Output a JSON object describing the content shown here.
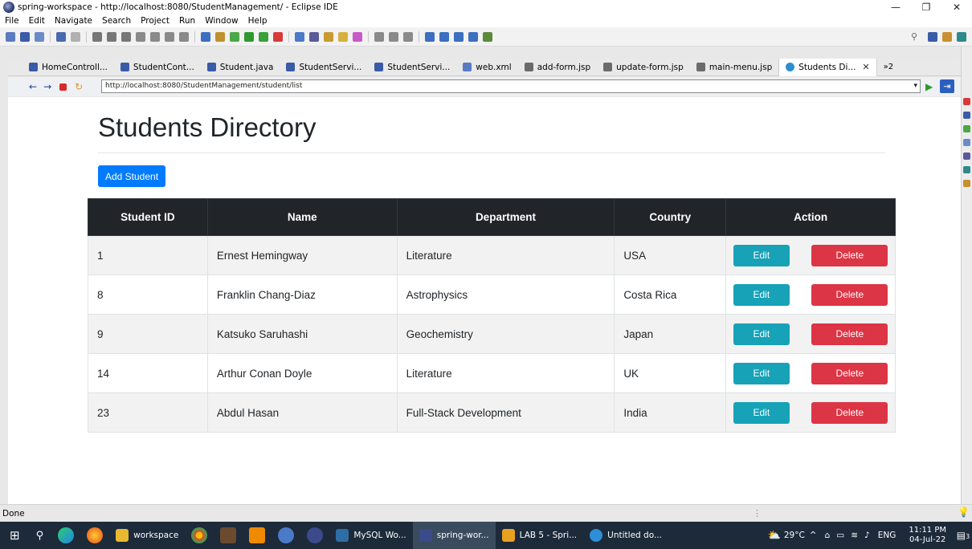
{
  "window": {
    "title": "spring-workspace - http://localhost:8080/StudentManagement/ - Eclipse IDE",
    "minimize": "—",
    "maximize": "❐",
    "close": "✕"
  },
  "menu": [
    "File",
    "Edit",
    "Navigate",
    "Search",
    "Project",
    "Run",
    "Window",
    "Help"
  ],
  "tabs": [
    {
      "label": "HomeControll...",
      "icon_color": "#3b5aa8"
    },
    {
      "label": "StudentCont...",
      "icon_color": "#3b5aa8"
    },
    {
      "label": "Student.java",
      "icon_color": "#3b5aa8"
    },
    {
      "label": "StudentServi...",
      "icon_color": "#3b5aa8"
    },
    {
      "label": "StudentServi...",
      "icon_color": "#3b5aa8"
    },
    {
      "label": "web.xml",
      "icon_color": "#5a7bc2"
    },
    {
      "label": "add-form.jsp",
      "icon_color": "#6b6b6b"
    },
    {
      "label": "update-form.jsp",
      "icon_color": "#6b6b6b"
    },
    {
      "label": "main-menu.jsp",
      "icon_color": "#6b6b6b"
    },
    {
      "label": "Students Di...",
      "icon_color": "#2c8fd0",
      "active": true
    }
  ],
  "tab_overflow": "»2",
  "browser": {
    "url": "http://localhost:8080/StudentManagement/student/list"
  },
  "page": {
    "title": "Students Directory",
    "add_button": "Add Student",
    "columns": [
      "Student ID",
      "Name",
      "Department",
      "Country",
      "Action"
    ],
    "edit_label": "Edit",
    "delete_label": "Delete",
    "rows": [
      {
        "id": "1",
        "name": "Ernest Hemingway",
        "department": "Literature",
        "country": "USA"
      },
      {
        "id": "8",
        "name": "Franklin Chang-Diaz",
        "department": "Astrophysics",
        "country": "Costa Rica"
      },
      {
        "id": "9",
        "name": "Katsuko Saruhashi",
        "department": "Geochemistry",
        "country": "Japan"
      },
      {
        "id": "14",
        "name": "Arthur Conan Doyle",
        "department": "Literature",
        "country": "UK"
      },
      {
        "id": "23",
        "name": "Abdul Hasan",
        "department": "Full-Stack Development",
        "country": "India"
      }
    ]
  },
  "status": {
    "text": "Done"
  },
  "taskbar": {
    "apps": [
      {
        "label": "workspace",
        "color": "#e8b830"
      },
      {
        "label": "MySQL Wo...",
        "color": "#2e6ea6"
      },
      {
        "label": "spring-wor...",
        "color": "#3a4a8a",
        "active": true
      },
      {
        "label": "LAB 5 - Spri...",
        "color": "#e8a020"
      },
      {
        "label": "Untitled do...",
        "color": "#2e8fd8"
      }
    ],
    "weather": "29°C",
    "lang": "ENG",
    "time": "11:11 PM",
    "date": "04-Jul-22",
    "notifications": "3"
  },
  "colors": {
    "primary": "#007bff",
    "info": "#17a2b8",
    "danger": "#dc3545",
    "table_head": "#212529"
  }
}
